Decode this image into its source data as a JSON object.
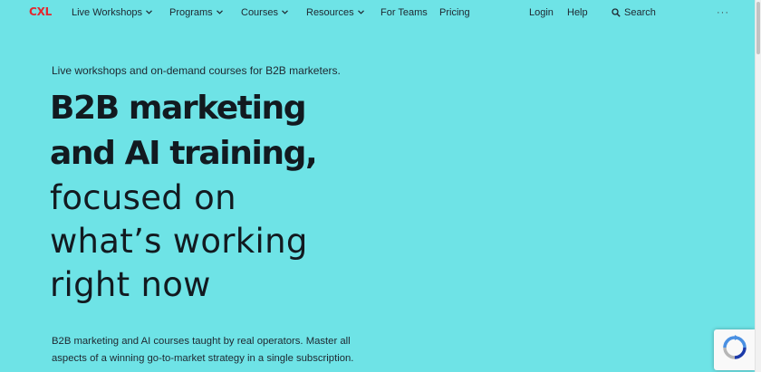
{
  "nav": {
    "logo": "CXL",
    "items": [
      {
        "label": "Live Workshops",
        "dropdown": true
      },
      {
        "label": "Programs",
        "dropdown": true
      },
      {
        "label": "Courses",
        "dropdown": true
      },
      {
        "label": "Resources",
        "dropdown": true
      },
      {
        "label": "For Teams",
        "dropdown": false
      },
      {
        "label": "Pricing",
        "dropdown": false
      }
    ],
    "login": "Login",
    "help": "Help",
    "search": "Search",
    "more": "···"
  },
  "hero": {
    "tagline": "Live workshops and on-demand courses for B2B marketers.",
    "headline_bold": [
      "B2B marketing",
      "and AI training,"
    ],
    "headline_light": [
      "focused on",
      "what’s working",
      "right now"
    ],
    "subtext": "B2B marketing and AI courses taught by real operators. Master all aspects of a winning go-to-market strategy in a single subscription."
  },
  "colors": {
    "background": "#6ee3e6",
    "logo": "#e3282f",
    "text": "#121a20"
  },
  "icons": {
    "search": "search-icon",
    "chevron": "chevron-down-icon",
    "recaptcha": "recaptcha-icon"
  }
}
